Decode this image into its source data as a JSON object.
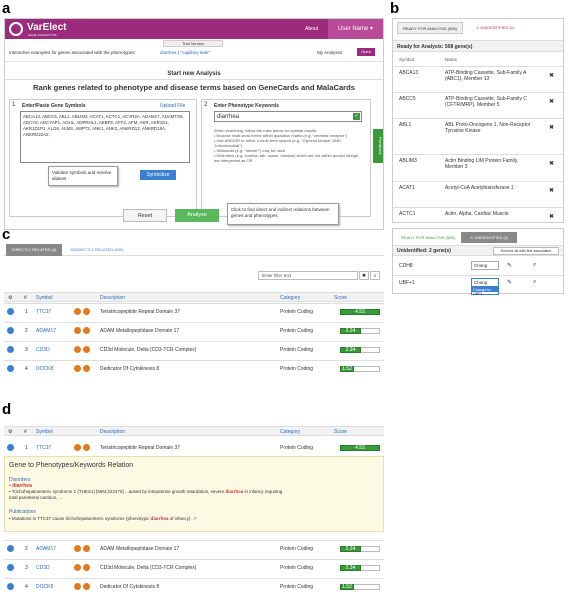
{
  "panels": {
    "a": "a",
    "b": "b",
    "c": "c",
    "d": "d"
  },
  "app": {
    "logo": "VarElect",
    "logo_sub": "GENE–PHENOTYPE",
    "nav_about": "About",
    "user_menu": "User Name ▾",
    "trial": "Trial Version",
    "examples_text": "Interactive examples for genes associated with the phenotypes:",
    "example_link": "diarrhea ( \"capillary leak\"",
    "my_analyses": "My Analyses:",
    "open_btn": "Open",
    "start_new": "Start new Analysis",
    "headline": "Rank genes related to phenotype and disease terms based on GeneCards and MalaCards",
    "step1_num": "1",
    "step1_title": "Enter/Paste Gene Symbols",
    "upload": "Upload File",
    "gene_text": "ABCA13, ABCC5, ABL1, ABLIM3, ACAT1, ACTC1, ACVR2A, ADAM17, ADAMTS6, ADCY8, ADCYAP1, AGHL, ADPRHL1, AEBP2, AFF2, AFM, AKR, AKR1D1, AKR1D1P1, ALG8, ALMS, AMPT2, ANK1, ANK2, ANKRD12, ANKRD18A, ANKRD22A2,",
    "tooltip_validate": "Validate symbols and resolve aliases",
    "symbolize": "Symbolize",
    "step2_num": "2",
    "step2_title": "Enter Phenotype Keywords",
    "keyword": "diarrhea",
    "tips": [
      "When searching, follow the rules below for optimal results:",
      "• Enclose multi-word terms within quotation marks (e.g. \"cerebral receptor\")",
      "• Use AND/OR to refine a multi-term search (e.g. \"Glycerol kinase\" AND \"mitochondrial\")",
      "• Wildcards (e.g. \"metab*\") may be used",
      "• Delimiters (e.g. comma, tab, space, newline) which are not within quoted strings are interpreted as OR"
    ],
    "side_tab": "Feedback",
    "reset": "Reset",
    "analyze": "Analyze",
    "tooltip_analyze": "Click to find direct and indirect relations between genes and phenotypes."
  },
  "panel_b": {
    "tab_ready": "READY FOR ANALYSIS (508)",
    "tab_undef": "⚠ UNIDENTIFIED (2)",
    "ready_header": "Ready for Analysis: 508 gene(s)",
    "col_symbol": "Symbol",
    "col_name": "Name",
    "rows": [
      {
        "symbol": "ABCA13",
        "name": "ATP-Binding Cassette, Sub-Family A (ABC1), Member 13"
      },
      {
        "symbol": "ABCC5",
        "name": "ATP-Binding Cassette, Sub-Family C (CFTR/MRP), Member 5"
      },
      {
        "symbol": "ABL1",
        "name": "ABL Proto-Oncogene 1, Non-Receptor Tyrosine Kinase"
      },
      {
        "symbol": "ABLIM3",
        "name": "Actin Binding LIM Protein Family, Member 3"
      },
      {
        "symbol": "ACAT1",
        "name": "Acetyl-CoA Acetyltransferase 1"
      },
      {
        "symbol": "ACTC1",
        "name": "Actin, Alpha, Cardiac Muscle"
      }
    ],
    "remove": "✖",
    "tab2_ready": "READY FOR ANALYSIS (508)",
    "tab2_undef": "⚠ UNIDENTIFIED (2)",
    "undef_header": "Unidentified: 2 gene(s)",
    "resolve_btn": "Resolve all with first association",
    "undef_rows": [
      {
        "symbol": "CDH8",
        "select": "Chang"
      },
      {
        "symbol": "UBF+1",
        "select": "Chang"
      }
    ],
    "dropdown": [
      "Change to:",
      "UBF1"
    ]
  },
  "panel_c": {
    "tab_direct": "DIRECTLY RELATED (4)",
    "tab_indirect": "INDIRECTLY RELATED (505)",
    "filter_placeholder": "Enter filter text",
    "headers": {
      "num": "#",
      "symbol": "Symbol",
      "description": "Description",
      "category": "Category",
      "score": "Score"
    },
    "rows": [
      {
        "n": "1",
        "symbol": "TTC37",
        "desc": "Tetratricopeptide Repeat Domain 37",
        "cat": "Protein Coding",
        "score": "4.53"
      },
      {
        "n": "2",
        "symbol": "ADAM17",
        "desc": "ADAM Metallopeptidase Domain 17",
        "cat": "Protein Coding",
        "score": "2.34"
      },
      {
        "n": "3",
        "symbol": "CD3D",
        "desc": "CD3d Molecule, Delta (CD3-TCR Complex)",
        "cat": "Protein Coding",
        "score": "2.34"
      },
      {
        "n": "4",
        "symbol": "DOCK8",
        "desc": "Dedicator Of Cytokinesis 8",
        "cat": "Protein Coding",
        "score": "1.52"
      }
    ]
  },
  "panel_d": {
    "rel_title": "Gene to Phenotypes/Keywords Relation",
    "disorders": "Disorders",
    "dis_term": "diarrhea",
    "dis_text_a": "• Trichohepatoenteric syndrome 1 (THES1) [MIM:222470] ...aused by intrauterine growth retardation, severe",
    "dis_text_b": "in infancy requiring total parenteral nutrition, ...",
    "publications": "Publications",
    "pub_text_a": "• Mutations in TTC37 cause trichohepatoenteric syndrome (phenotypic",
    "pub_text_b": "of infancy)."
  },
  "score_fracs": [
    1.0,
    0.52,
    0.52,
    0.34
  ],
  "colors": {
    "purple": "#9c2b7e",
    "green": "#3a9a3a",
    "blue": "#3b7fd0",
    "orange": "#e07b1e"
  }
}
